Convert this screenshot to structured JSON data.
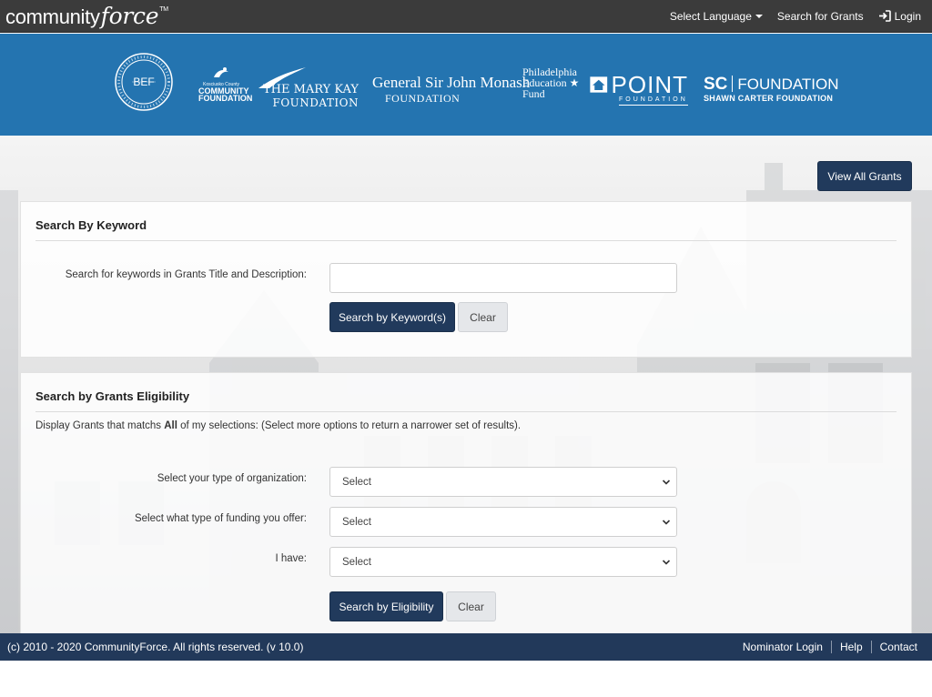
{
  "nav": {
    "brand_prefix": "community",
    "brand_suffix": "force",
    "brand_tm": "TM",
    "select_language": "Select Language",
    "search_grants": "Search for Grants",
    "login": "Login"
  },
  "banner": {
    "logos": {
      "bef": "BEF",
      "kcf_line1": "Kosciusko County",
      "kcf_line2": "COMMUNITY",
      "kcf_line3": "FOUNDATION",
      "marykay_line1": "THE MARY KAY",
      "marykay_line2": "FOUNDATION",
      "monash_line1": "General Sir John Monash",
      "monash_line2": "FOUNDATION",
      "phila_line1": "Philadelphia",
      "phila_line2": "Education",
      "phila_line3": "Fund",
      "point_word": "POINT",
      "point_sub": "FOUNDATION",
      "scf_abbr": "SC",
      "scf_word": "FOUNDATION",
      "scf_sub": "SHAWN CARTER FOUNDATION"
    }
  },
  "view_all_label": "View All Grants",
  "keyword": {
    "title": "Search By Keyword",
    "field_label": "Search for keywords in Grants Title and Description:",
    "field_value": "",
    "search_label": "Search by Keyword(s)",
    "clear_label": "Clear"
  },
  "eligibility": {
    "title": "Search by Grants Eligibility",
    "desc_before": "Display Grants that matchs ",
    "desc_bold": "All",
    "desc_after": " of my selections: (Select more options to return a narrower set of results).",
    "fields": [
      {
        "label": "Select your type of organization:",
        "value": "Select"
      },
      {
        "label": "Select what type of funding you offer:",
        "value": "Select"
      },
      {
        "label": "I have:",
        "value": "Select"
      }
    ],
    "search_label": "Search by Eligibility",
    "clear_label": "Clear"
  },
  "footer": {
    "copyright": "(c) 2010 - 2020 CommunityForce. All rights reserved. (v 10.0)",
    "links": [
      "Nominator Login",
      "Help",
      "Contact"
    ]
  },
  "colors": {
    "nav_bg": "#3b3b3b",
    "banner_bg": "#2474b0",
    "primary_button": "#213a5c",
    "footer_bg": "#22395a"
  }
}
